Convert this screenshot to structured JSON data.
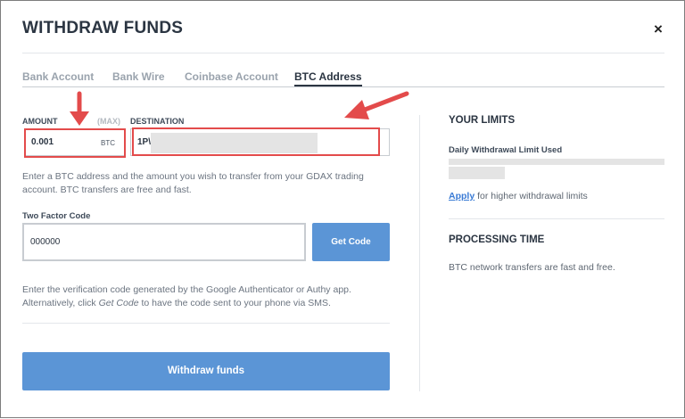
{
  "modal": {
    "title": "WITHDRAW FUNDS",
    "close_glyph": "×"
  },
  "tabs": [
    {
      "label": "Bank Account",
      "active": false
    },
    {
      "label": "Bank Wire",
      "active": false
    },
    {
      "label": "Coinbase Account",
      "active": false
    },
    {
      "label": "BTC Address",
      "active": true
    }
  ],
  "form": {
    "amount_label": "AMOUNT",
    "max_label": "(MAX)",
    "amount_value": "0.001",
    "amount_unit": "BTC",
    "destination_label": "DESTINATION",
    "destination_value": "1P\\",
    "info_text": "Enter a BTC address and the amount you wish to transfer from your GDAX trading account. BTC transfers are free and fast.",
    "two_factor_label": "Two Factor Code",
    "two_factor_value": "000000",
    "get_code_label": "Get Code",
    "verify_text_1": "Enter the verification code generated by the Google Authenticator or Authy app.",
    "verify_text_2a": "Alternatively, click ",
    "verify_text_2b": "Get Code",
    "verify_text_2c": " to have the code sent to your phone via SMS.",
    "withdraw_label": "Withdraw funds"
  },
  "limits": {
    "heading": "YOUR LIMITS",
    "daily_label": "Daily Withdrawal Limit Used",
    "apply_link": "Apply",
    "apply_suffix": " for higher withdrawal limits"
  },
  "processing": {
    "heading": "PROCESSING TIME",
    "text": "BTC network transfers are fast and free."
  },
  "colors": {
    "accent": "#5b95d6",
    "annotation": "#e34b4b",
    "link": "#3a7bd5"
  }
}
